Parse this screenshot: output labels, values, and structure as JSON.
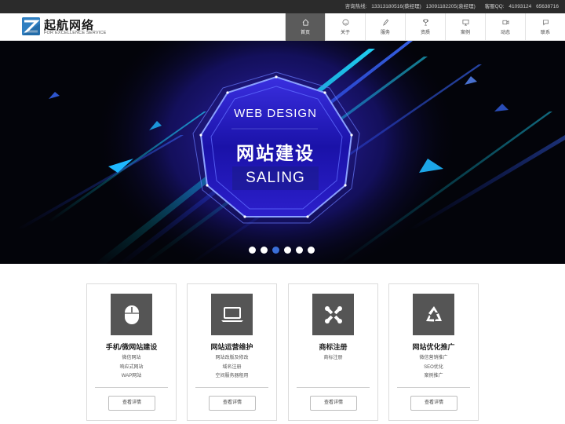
{
  "topbar": {
    "hotline_label": "咨询热线:",
    "phone1": "13313180516",
    "phone1_name": "(蔡经理)",
    "phone2": "13091182205",
    "phone2_name": "(袁经理)",
    "qq_label": "客服QQ:",
    "qq1": "41093124",
    "qq2": "65638716"
  },
  "logo": {
    "title": "起航网络",
    "subtitle": "FOR EXCELLENCE SERVICE"
  },
  "nav": {
    "items": [
      {
        "label": "首页",
        "icon": "home-icon"
      },
      {
        "label": "关于",
        "icon": "smile-icon"
      },
      {
        "label": "服务",
        "icon": "pen-icon"
      },
      {
        "label": "资质",
        "icon": "trophy-icon"
      },
      {
        "label": "案例",
        "icon": "monitor-icon"
      },
      {
        "label": "动态",
        "icon": "video-icon"
      },
      {
        "label": "联系",
        "icon": "chat-icon"
      }
    ],
    "active_index": 0
  },
  "banner": {
    "line1": "WEB DESIGN",
    "line2": "网站建设",
    "line3": "SALING",
    "slide_count": 6,
    "active_slide": 2
  },
  "services": [
    {
      "title": "手机/微网站建设",
      "icon": "mouse-icon",
      "lines": [
        "微信网站",
        "响应式网站",
        "WAP网站"
      ],
      "button": "查看详情"
    },
    {
      "title": "网站运营维护",
      "icon": "laptop-icon",
      "lines": [
        "网站改版及修改",
        "域名注册",
        "空间服务器租用"
      ],
      "button": "查看详情"
    },
    {
      "title": "商标注册",
      "icon": "joomla-icon",
      "lines": [
        "商标注册"
      ],
      "button": "查看详情"
    },
    {
      "title": "网站优化推广",
      "icon": "recycle-icon",
      "lines": [
        "微信营销推广",
        "SEO优化",
        "案例推广"
      ],
      "button": "查看详情"
    }
  ],
  "colors": {
    "topbar_bg": "#2b2b2b",
    "nav_active_bg": "#5b5b5b",
    "slider_active_dot": "#3b6fd8",
    "card_icon_bg": "#555555",
    "logo_blue": "#2f7fc1"
  }
}
